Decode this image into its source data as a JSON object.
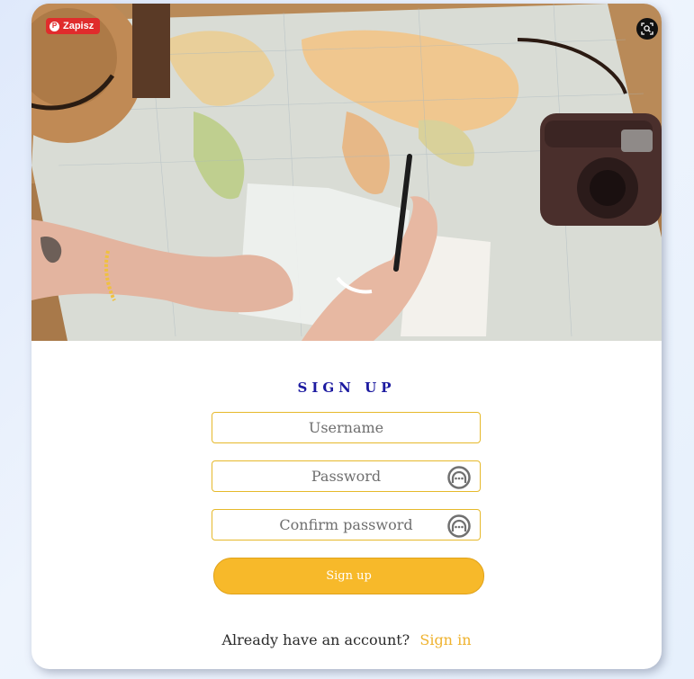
{
  "hero": {
    "pin_label": "Zapisz",
    "pin_icon": "pinterest-icon",
    "lens_icon": "visual-search-icon"
  },
  "form": {
    "title": "SIGN UP",
    "username_placeholder": "Username",
    "password_placeholder": "Password",
    "confirm_placeholder": "Confirm password",
    "toggle_icon": "password-visibility-icon",
    "submit_label": "Sign up",
    "footer_text": "Already have an account?",
    "footer_link": "Sign in"
  },
  "colors": {
    "title": "#1c1aa0",
    "accent": "#f7b92a",
    "field_border": "#e6b92b",
    "link": "#efb22e",
    "pin_badge": "#e02c2c"
  }
}
